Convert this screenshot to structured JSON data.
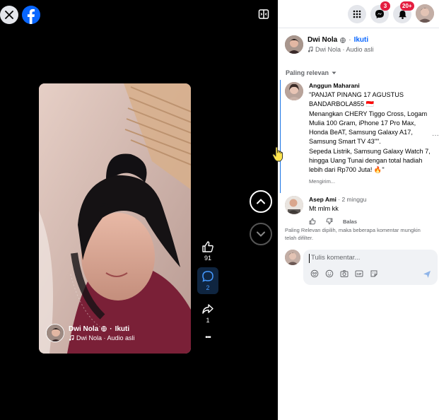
{
  "stage": {
    "close_icon": "close-icon",
    "logo_icon": "facebook-logo-icon",
    "expand_icon": "toggle-panel-icon",
    "video": {
      "author_name": "Dwi Nola",
      "follow_label": "Ikuti",
      "separator": "·",
      "audio_label": "Dwi Nola · Audio asli"
    },
    "actions": {
      "likes": "91",
      "comments": "2",
      "shares": "1",
      "more": "•••"
    }
  },
  "topbar": {
    "menu_icon": "apps-grid-icon",
    "messenger_badge": "3",
    "notifications_badge": "20+"
  },
  "panel": {
    "author_name": "Dwi Nola",
    "follow_label": "Ikuti",
    "audio_label": "Dwi Nola · Audio asli",
    "sort_label": "Paling relevan"
  },
  "comments": [
    {
      "name": "Anggun Maharani",
      "text": "\"PANJAT PINANG 17 AGUSTUS BANDARBOLA855 🇮🇩\nMenangkan CHERY Tiggo Cross, Logam Mulia 100 Gram, iPhone 17 Pro Max, Honda BeAT, Samsung Galaxy A17, Samsung Smart TV 43\"\".\nSepeda Listrik, Samsung Galaxy Watch 7, hingga Uang Tunai dengan total hadiah lebih dari Rp700 Juta! 🔥\"",
      "status": "Mengirim..."
    },
    {
      "name": "Asep Ami",
      "time": "2 minggu",
      "text": "Mt mlm kk",
      "reply_label": "Balas"
    }
  ],
  "filter_note": "Paling Relevan dipilih, maka beberapa komentar mungkin telah difilter.",
  "composer": {
    "placeholder": "Tulis komentar..."
  },
  "colors": {
    "brand": "#0866ff",
    "badge": "#e41e3f",
    "stage_bg": "#000000"
  }
}
